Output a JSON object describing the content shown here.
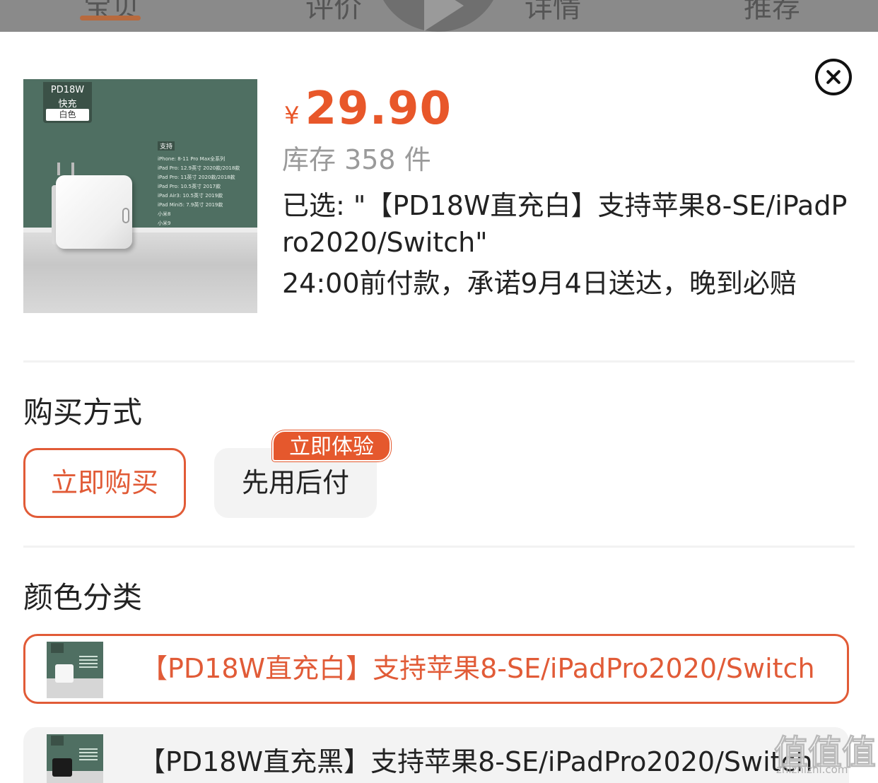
{
  "top_tabs": {
    "tabs": [
      "宝贝",
      "评价",
      "详情",
      "推荐"
    ]
  },
  "product": {
    "thumb": {
      "tag_line1": "PD18W",
      "tag_line2": "快充",
      "tag_pill": "白色",
      "support_title": "支持",
      "support_lines": [
        "iPhone: 8-11 Pro Max全系列",
        "iPad Pro: 12.9英寸 2020款/2018款",
        "iPad Pro: 11英寸 2020款/2018款",
        "iPad Pro: 10.5英寸 2017款",
        "iPad Air3: 10.5英寸 2019款",
        "iPad Mini5: 7.9英寸 2019款",
        "小米8",
        "小米9"
      ]
    },
    "price_symbol": "¥",
    "price": "29.90",
    "stock": "库存 358 件",
    "selected": "已选: \"【PD18W直充白】支持苹果8-SE/iPadPro2020/Switch\"",
    "promise": "24:00前付款，承诺9月4日送达，晚到必赔"
  },
  "purchase_method": {
    "title": "购买方式",
    "options": [
      {
        "label": "立即购买",
        "selected": true
      },
      {
        "label": "先用后付",
        "selected": false,
        "badge": "立即体验"
      }
    ]
  },
  "color_category": {
    "title": "颜色分类",
    "items": [
      {
        "label": "【PD18W直充白】支持苹果8-SE/iPadPro2020/Switch",
        "selected": true
      },
      {
        "label": "【PD18W直充黑】支持苹果8-SE/iPadPro2020/Switch",
        "selected": false
      }
    ]
  },
  "watermark": {
    "text": "值值值",
    "sub": "zhizhizhi.com"
  },
  "colors": {
    "accent": "#e15b37",
    "price": "#e8572a",
    "muted": "#9a9a9a",
    "option_bg": "#f3f3f3"
  },
  "icons": {
    "close": "close-circle-icon"
  }
}
